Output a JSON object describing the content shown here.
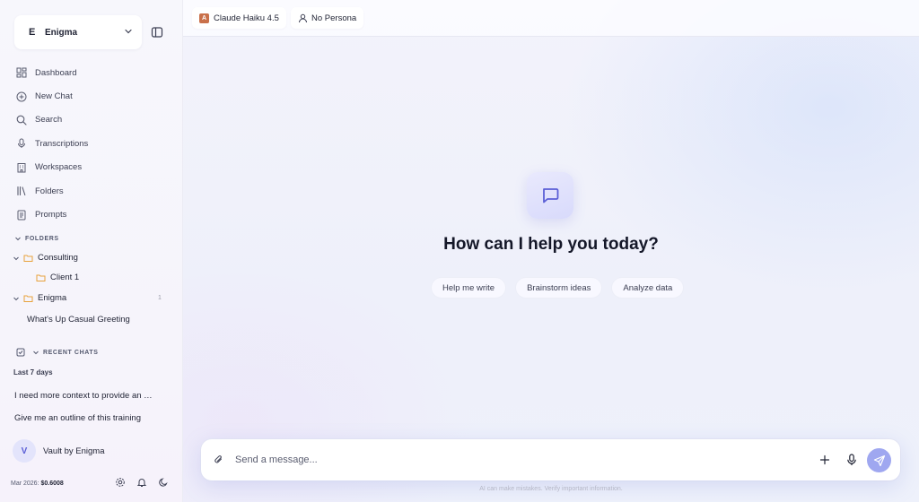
{
  "workspace": {
    "letter": "E",
    "name": "Enigma"
  },
  "nav": [
    {
      "label": "Dashboard",
      "icon": "dashboard-icon"
    },
    {
      "label": "New Chat",
      "icon": "plus-circle-icon"
    },
    {
      "label": "Search",
      "icon": "search-icon"
    },
    {
      "label": "Transcriptions",
      "icon": "mic-icon"
    },
    {
      "label": "Workspaces",
      "icon": "building-icon"
    },
    {
      "label": "Folders",
      "icon": "library-icon"
    },
    {
      "label": "Prompts",
      "icon": "document-icon"
    }
  ],
  "folders": {
    "section_label": "FOLDERS",
    "items": [
      {
        "label": "Consulting"
      },
      {
        "label": "Client 1"
      },
      {
        "label": "Enigma",
        "count": "1"
      },
      {
        "label": "What's Up Casual Greeting"
      }
    ]
  },
  "recent": {
    "section_label": "RECENT CHATS",
    "group_label": "Last 7 days",
    "chats": [
      {
        "label": "I need more context to provide an …"
      },
      {
        "label": "Give me an outline of this training"
      }
    ]
  },
  "user": {
    "initial": "V",
    "name": "Vault by Enigma"
  },
  "usage": {
    "period": "Mar 2026:",
    "amount": "$0.6008"
  },
  "topbar": {
    "model": "Claude Haiku 4.5",
    "persona": "No Persona"
  },
  "hero": {
    "title": "How can I help you today?"
  },
  "suggestions": [
    "Help me write",
    "Brainstorm ideas",
    "Analyze data"
  ],
  "composer": {
    "placeholder": "Send a message..."
  },
  "disclaimer": "AI can make mistakes. Verify important information.",
  "colors": {
    "accent": "#5b5fd6",
    "send": "#9fa7f0",
    "folder": "#e8a23c"
  }
}
